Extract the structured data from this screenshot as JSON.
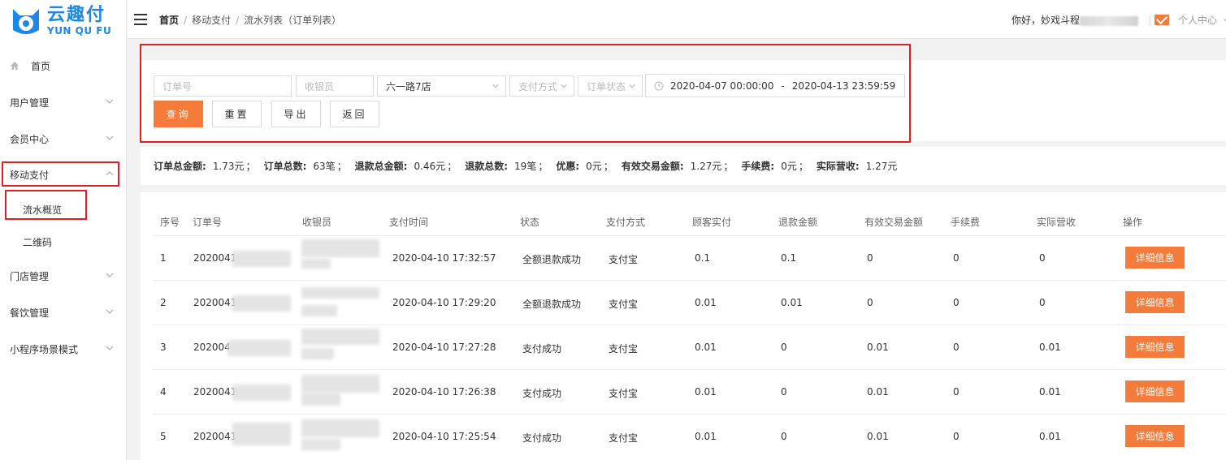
{
  "brand": {
    "name_cn": "云趣付",
    "name_en": "YUN QU FU",
    "color": "#1e88e5"
  },
  "accent_color": "#f47b3a",
  "highlight_color": "#e02020",
  "sidebar": {
    "items": [
      {
        "label": "首页",
        "icon": "home-icon"
      },
      {
        "label": "用户管理"
      },
      {
        "label": "会员中心"
      },
      {
        "label": "移动支付",
        "expanded": true
      },
      {
        "label": "门店管理"
      },
      {
        "label": "餐饮管理"
      },
      {
        "label": "小程序场景模式"
      }
    ],
    "sub_items": [
      {
        "label": "流水概览"
      },
      {
        "label": "二维码"
      }
    ]
  },
  "header": {
    "breadcrumb": [
      "首页",
      "移动支付",
      "流水列表（订单列表）"
    ],
    "greeting": "你好，妙戏斗程",
    "user_center": "个人中心"
  },
  "search": {
    "order_no_placeholder": "订单号",
    "cashier_placeholder": "收银员",
    "store_value": "六一路7店",
    "pay_method_placeholder": "支付方式",
    "order_status_placeholder": "订单状态",
    "date_start": "2020-04-07 00:00:00",
    "date_sep": "-",
    "date_end": "2020-04-13 23:59:59",
    "buttons": {
      "query": "查询",
      "reset": "重置",
      "export": "导出",
      "back": "返回"
    }
  },
  "summary": [
    {
      "label": "订单总金额:",
      "value": "1.73元"
    },
    {
      "label": "订单总数:",
      "value": "63笔"
    },
    {
      "label": "退款总金额:",
      "value": "0.46元"
    },
    {
      "label": "退款总数:",
      "value": "19笔"
    },
    {
      "label": "优惠:",
      "value": "0元"
    },
    {
      "label": "有效交易金额:",
      "value": "1.27元"
    },
    {
      "label": "手续费:",
      "value": "0元"
    },
    {
      "label": "实际营收:",
      "value": "1.27元"
    }
  ],
  "table": {
    "columns": [
      "序号",
      "订单号",
      "收银员",
      "支付时间",
      "状态",
      "支付方式",
      "顾客实付",
      "退款金额",
      "有效交易金额",
      "手续费",
      "实际营收",
      "操作"
    ],
    "action_label": "详细信息",
    "rows": [
      {
        "no": "1",
        "order": "2020041",
        "time": "2020-04-10 17:32:57",
        "status": "全额退款成功",
        "method": "支付宝",
        "paid": "0.1",
        "refund": "0.1",
        "valid": "0",
        "fee": "0",
        "revenue": "0"
      },
      {
        "no": "2",
        "order": "2020041",
        "time": "2020-04-10 17:29:20",
        "status": "全额退款成功",
        "method": "支付宝",
        "paid": "0.01",
        "refund": "0.01",
        "valid": "0",
        "fee": "0",
        "revenue": "0"
      },
      {
        "no": "3",
        "order": "202004",
        "time": "2020-04-10 17:27:28",
        "status": "支付成功",
        "method": "支付宝",
        "paid": "0.01",
        "refund": "0",
        "valid": "0.01",
        "fee": "0",
        "revenue": "0.01"
      },
      {
        "no": "4",
        "order": "2020041",
        "time": "2020-04-10 17:26:38",
        "status": "支付成功",
        "method": "支付宝",
        "paid": "0.01",
        "refund": "0",
        "valid": "0.01",
        "fee": "0",
        "revenue": "0.01"
      },
      {
        "no": "5",
        "order": "2020041",
        "time": "2020-04-10 17:25:54",
        "status": "支付成功",
        "method": "支付宝",
        "paid": "0.01",
        "refund": "0",
        "valid": "0.01",
        "fee": "0",
        "revenue": "0.01"
      }
    ]
  }
}
